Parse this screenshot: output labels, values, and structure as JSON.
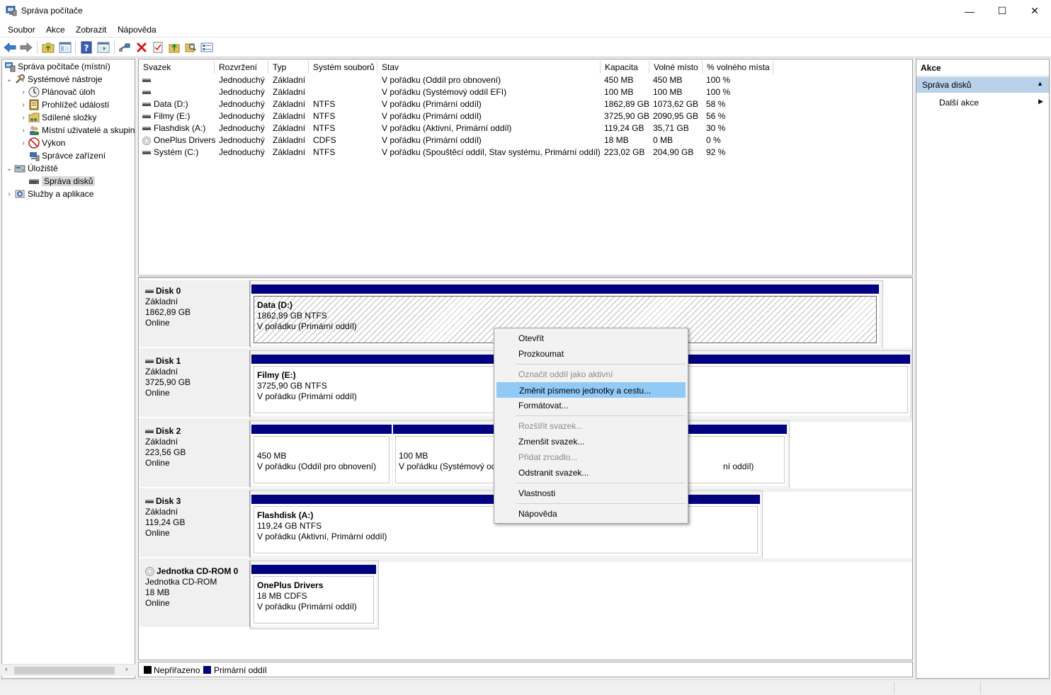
{
  "window": {
    "title": "Správa počítače",
    "controls": {
      "minimize": "—",
      "maximize": "☐",
      "close": "✕"
    }
  },
  "menu": [
    "Soubor",
    "Akce",
    "Zobrazit",
    "Nápověda"
  ],
  "toolbar_icons": [
    "back-arrow-icon",
    "forward-arrow-icon",
    "folder-up-icon",
    "show-hide-tree-icon",
    "help-icon",
    "properties-icon",
    "connect-icon",
    "delete-icon",
    "check-icon",
    "up-icon",
    "search-icon",
    "list-icon"
  ],
  "tree": {
    "root": "Správa počítače (místní)",
    "system_tools": "Systémové nástroje",
    "task_scheduler": "Plánovač úloh",
    "event_viewer": "Prohlížeč událostí",
    "shared_folders": "Sdílené složky",
    "local_users": "Místní uživatelé a skupiny",
    "performance": "Výkon",
    "device_manager": "Správce zařízení",
    "storage": "Úložiště",
    "disk_management": "Správa disků",
    "services": "Služby a aplikace"
  },
  "volumes": {
    "columns": [
      "Svazek",
      "Rozvržení",
      "Typ",
      "Systém souborů",
      "Stav",
      "Kapacita",
      "Volné místo",
      "% volného místa"
    ],
    "rows": [
      {
        "name": "",
        "layout": "Jednoduchý",
        "type": "Základní",
        "fs": "",
        "status": "V pořádku (Oddíl pro obnovení)",
        "capacity": "450 MB",
        "free": "450 MB",
        "pct": "100 %"
      },
      {
        "name": "",
        "layout": "Jednoduchý",
        "type": "Základní",
        "fs": "",
        "status": "V pořádku (Systémový oddíl EFI)",
        "capacity": "100 MB",
        "free": "100 MB",
        "pct": "100 %"
      },
      {
        "name": "Data (D:)",
        "layout": "Jednoduchý",
        "type": "Základní",
        "fs": "NTFS",
        "status": "V pořádku (Primární oddíl)",
        "capacity": "1862,89 GB",
        "free": "1073,62 GB",
        "pct": "58 %"
      },
      {
        "name": "Filmy (E:)",
        "layout": "Jednoduchý",
        "type": "Základní",
        "fs": "NTFS",
        "status": "V pořádku (Primární oddíl)",
        "capacity": "3725,90 GB",
        "free": "2090,95 GB",
        "pct": "56 %"
      },
      {
        "name": "Flashdisk (A:)",
        "layout": "Jednoduchý",
        "type": "Základní",
        "fs": "NTFS",
        "status": "V pořádku (Aktivní, Primární oddíl)",
        "capacity": "119,24 GB",
        "free": "35,71 GB",
        "pct": "30 %"
      },
      {
        "name": "OnePlus Drivers",
        "layout": "Jednoduchý",
        "type": "Základní",
        "fs": "CDFS",
        "status": "V pořádku (Primární oddíl)",
        "capacity": "18 MB",
        "free": "0 MB",
        "pct": "0 %"
      },
      {
        "name": "Systém (C:)",
        "layout": "Jednoduchý",
        "type": "Základní",
        "fs": "NTFS",
        "status": "V pořádku (Spouštěcí oddíl, Stav systému, Primární oddíl)",
        "capacity": "223,02 GB",
        "free": "204,90 GB",
        "pct": "92 %"
      }
    ]
  },
  "disks": [
    {
      "name": "Disk 0",
      "type": "Základní",
      "size": "1862,89 GB",
      "state": "Online",
      "parts": [
        {
          "name": "Data  (D:)",
          "size": "1862,89 GB NTFS",
          "status": "V pořádku (Primární oddíl)"
        }
      ]
    },
    {
      "name": "Disk 1",
      "type": "Základní",
      "size": "3725,90 GB",
      "state": "Online",
      "parts": [
        {
          "name": "Filmy  (E:)",
          "size": "3725,90 GB NTFS",
          "status": "V pořádku (Primární oddíl)"
        }
      ]
    },
    {
      "name": "Disk 2",
      "type": "Základní",
      "size": "223,56 GB",
      "state": "Online",
      "parts": [
        {
          "name": "",
          "size": "450 MB",
          "status": "V pořádku (Oddíl pro obnovení)"
        },
        {
          "name": "",
          "size": "100 MB",
          "status": "V pořádku (Systémový oddíl EFI)"
        },
        {
          "name": "",
          "size": "",
          "status": "ní oddíl)"
        }
      ]
    },
    {
      "name": "Disk 3",
      "type": "Základní",
      "size": "119,24 GB",
      "state": "Online",
      "parts": [
        {
          "name": "Flashdisk  (A:)",
          "size": "119,24 GB NTFS",
          "status": "V pořádku (Aktivní, Primární oddíl)"
        }
      ]
    },
    {
      "name": "Jednotka CD-ROM 0",
      "type": "Jednotka CD-ROM",
      "size": "18 MB",
      "state": "Online",
      "parts": [
        {
          "name": "OnePlus Drivers",
          "size": "18 MB CDFS",
          "status": "V pořádku (Primární oddíl)"
        }
      ]
    }
  ],
  "legend": [
    {
      "label": "Nepřiřazeno",
      "color": "#000000"
    },
    {
      "label": "Primární oddíl",
      "color": "#000080"
    }
  ],
  "actions": {
    "header": "Akce",
    "section": "Správa disků",
    "more": "Další akce"
  },
  "context_menu": [
    {
      "label": "Otevřít",
      "disabled": false
    },
    {
      "label": "Prozkoumat",
      "disabled": false
    },
    {
      "label": "Označit oddíl jako aktivní",
      "disabled": true
    },
    {
      "label": "Změnit písmeno jednotky a cestu...",
      "disabled": false,
      "highlighted": true
    },
    {
      "label": "Formátovat...",
      "disabled": false
    },
    {
      "label": "Rozšířit svazek...",
      "disabled": true
    },
    {
      "label": "Zmenšit svazek...",
      "disabled": false
    },
    {
      "label": "Přidat zrcadlo...",
      "disabled": true
    },
    {
      "label": "Odstranit svazek...",
      "disabled": false
    },
    {
      "label": "Vlastnosti",
      "disabled": false
    },
    {
      "label": "Nápověda",
      "disabled": false
    }
  ],
  "colors": {
    "primary_partition": "#000080",
    "selection": "#91c9f7",
    "action_header": "#b9d1ea"
  }
}
